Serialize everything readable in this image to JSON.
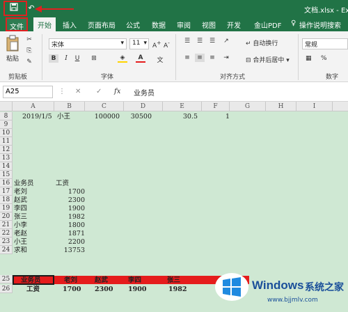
{
  "title_bar": {
    "filename_title": "文档.xlsx - Exc"
  },
  "ribbon_tabs": [
    "文件",
    "开始",
    "插入",
    "页面布局",
    "公式",
    "数据",
    "审阅",
    "视图",
    "开发",
    "金山PDF",
    "操作说明搜索"
  ],
  "ribbon": {
    "paste_label": "粘贴",
    "font_name": "宋体",
    "font_size": "11",
    "wrap_text": "自动换行",
    "merge_center": "合并后居中",
    "number_format": "常规",
    "group_clipboard": "剪贴板",
    "group_font": "字体",
    "group_alignment": "对齐方式",
    "group_number": "数字"
  },
  "formula_bar": {
    "name_box": "A25",
    "fx": "fx",
    "value": "业务员"
  },
  "columns": [
    "A",
    "B",
    "C",
    "D",
    "E",
    "F",
    "G",
    "H",
    "I"
  ],
  "rows": [
    "8",
    "9",
    "10",
    "11",
    "12",
    "13",
    "14",
    "15",
    "16",
    "17",
    "18",
    "19",
    "20",
    "21",
    "22",
    "23",
    "24",
    "25",
    "26"
  ],
  "cells": {
    "r8": {
      "a": "2019/1/5",
      "b": "小王",
      "c": "100000",
      "d": "30500",
      "e": "30.5",
      "f": "1"
    },
    "r14": {
      "a": "业务员",
      "b": "工资"
    },
    "list": [
      {
        "name": "老刘",
        "value": "1700"
      },
      {
        "name": "赵武",
        "value": "2300"
      },
      {
        "name": "李四",
        "value": "1900"
      },
      {
        "name": "张三",
        "value": "1982"
      },
      {
        "name": "小李",
        "value": "1800"
      },
      {
        "name": "老赵",
        "value": "1871"
      },
      {
        "name": "小王",
        "value": "2200"
      },
      {
        "name": "求和",
        "value": "13753"
      }
    ],
    "r25": [
      "业务员",
      "老刘",
      "赵武",
      "李四",
      "张三"
    ],
    "r26": [
      "工资",
      "1700",
      "2300",
      "1900",
      "1982"
    ]
  },
  "watermark": {
    "brand": "Windows",
    "brand_cn": "系统之家",
    "url": "www.bjjmlv.com"
  },
  "colors": {
    "excel_green": "#217346",
    "sheet_bg": "#cfe8d3",
    "highlight_red": "#e51c1c"
  }
}
